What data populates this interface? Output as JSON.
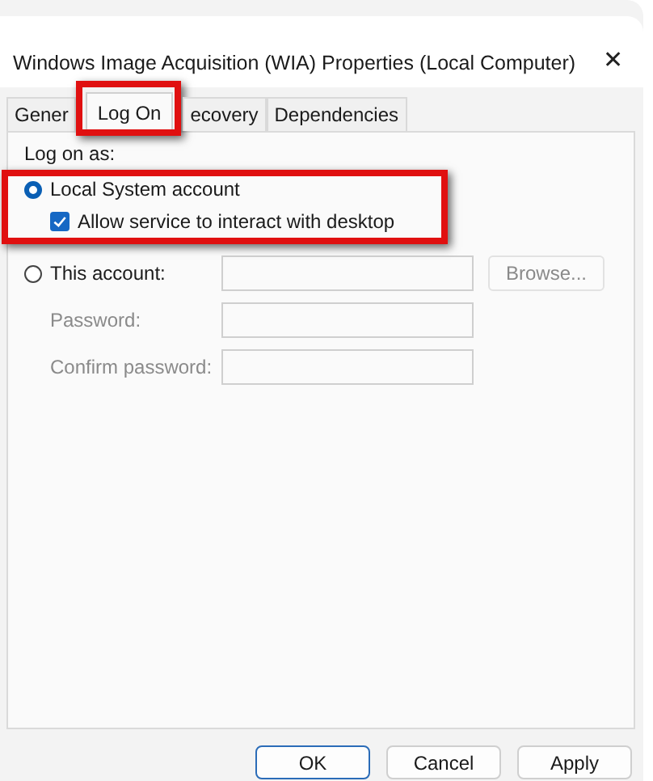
{
  "window": {
    "title": "Windows Image Acquisition (WIA) Properties (Local Computer)",
    "close": "✕"
  },
  "tabs": [
    {
      "label": "Gener",
      "selected": false
    },
    {
      "label": "Log On",
      "selected": true
    },
    {
      "label": "ecovery",
      "selected": false
    },
    {
      "label": "Dependencies",
      "selected": false
    }
  ],
  "heading": "Log on as:",
  "options": [
    {
      "label": "Local System account",
      "selected": true
    },
    {
      "label": "This account:",
      "selected": false
    }
  ],
  "interact_checkbox": {
    "label": "Allow service to interact with desktop",
    "checked": true
  },
  "browse_button": {
    "label": "Browse...",
    "disabled": true
  },
  "password_fields": [
    {
      "label": "Password:",
      "disabled": true
    },
    {
      "label": "Confirm password:",
      "disabled": true
    }
  ],
  "buttons": [
    {
      "label": "OK",
      "default": true
    },
    {
      "label": "Cancel",
      "default": false
    },
    {
      "label": "Apply",
      "default": false
    }
  ]
}
